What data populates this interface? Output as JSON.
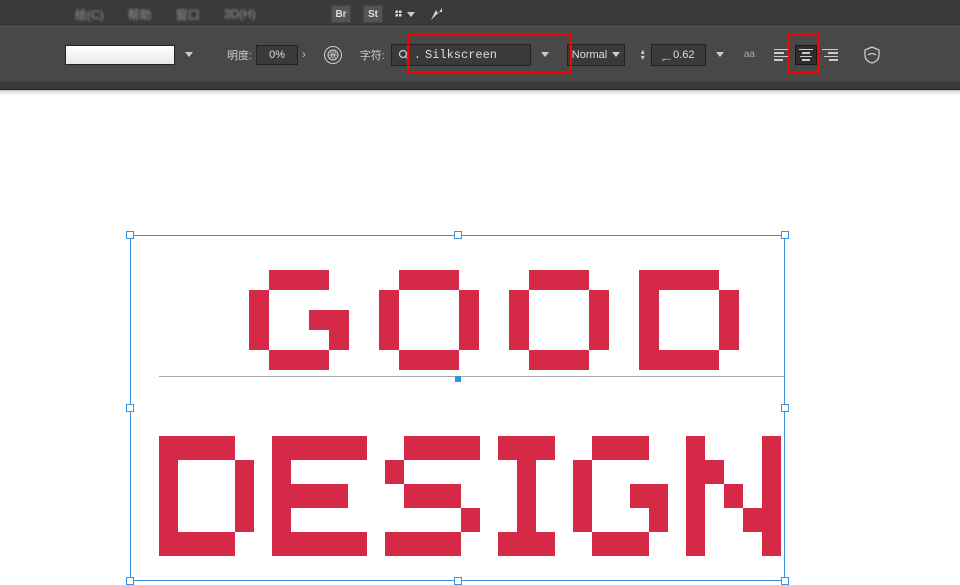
{
  "menubar": {
    "m1": "绘(C)",
    "m2": "帮助",
    "m3": "窗口",
    "m4": "3D(H)",
    "icons": {
      "br": "Br",
      "st": "St"
    }
  },
  "optbar": {
    "opacity_label": "明度:",
    "opacity_value": "0%",
    "font_label": "字符:",
    "font_family": "Silkscreen",
    "font_style": "Normal",
    "font_size": "0.62",
    "aa_label": "aa"
  },
  "highlights": {
    "font": true,
    "align": true
  },
  "canvas_text": {
    "line1": "GOOD",
    "line2": "DESIGN"
  }
}
